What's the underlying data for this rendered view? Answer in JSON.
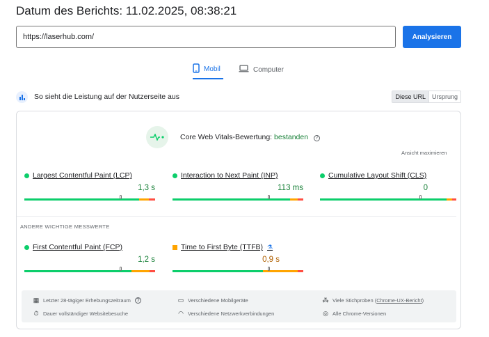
{
  "header": {
    "report_date": "Datum des Berichts: 11.02.2025, 08:38:21"
  },
  "analysis": {
    "url_value": "https://laserhub.com/",
    "analyze_label": "Analysieren"
  },
  "device_tabs": {
    "mobile": "Mobil",
    "desktop": "Computer"
  },
  "field_section": {
    "title": "So sieht die Leistung auf der Nutzerseite aus",
    "toggle_this_url": "Diese URL",
    "toggle_origin": "Ursprung"
  },
  "cwv": {
    "label": "Core Web Vitals-Bewertung:",
    "status": "bestanden",
    "expand": "Ansicht maximieren"
  },
  "metrics": [
    {
      "name": "Largest Contentful Paint (LCP)",
      "value": "1,3 s",
      "rating": "good",
      "distribution": {
        "good": 0.88,
        "avg": 0.07,
        "poor": 0.05
      },
      "marker": 0.74
    },
    {
      "name": "Interaction to Next Paint (INP)",
      "value": "113 ms",
      "rating": "good",
      "distribution": {
        "good": 0.9,
        "avg": 0.06,
        "poor": 0.04
      },
      "marker": 0.74
    },
    {
      "name": "Cumulative Layout Shift (CLS)",
      "value": "0",
      "rating": "good",
      "distribution": {
        "good": 0.93,
        "avg": 0.04,
        "poor": 0.03
      },
      "marker": 0.74
    }
  ],
  "other_metrics_label": "ANDERE WICHTIGE MESSWERTE",
  "other_metrics": [
    {
      "name": "First Contentful Paint (FCP)",
      "value": "1,2 s",
      "rating": "good",
      "distribution": {
        "good": 0.82,
        "avg": 0.14,
        "poor": 0.04
      },
      "marker": 0.74
    },
    {
      "name": "Time to First Byte (TTFB)",
      "value": "0,9 s",
      "rating": "average",
      "distribution": {
        "good": 0.69,
        "avg": 0.27,
        "poor": 0.04
      },
      "marker": 0.74
    }
  ],
  "footer": {
    "collection_period": "Letzter 28-tägiger Erhebungszeitraum",
    "devices": "Verschiedene Mobilgeräte",
    "samples_prefix": "Viele Stichproben (",
    "samples_link": "Chrome-UX-Bericht",
    "samples_suffix": ")",
    "visit_duration": "Dauer vollständiger Websitebesuche",
    "connections": "Verschiedene Netzwerkverbindungen",
    "chrome_versions": "Alle Chrome-Versionen"
  },
  "colors": {
    "good": "#0cce6b",
    "average": "#ffa400",
    "poor": "#ff4e42",
    "accent": "#1a73e8",
    "good_text": "#188038"
  }
}
